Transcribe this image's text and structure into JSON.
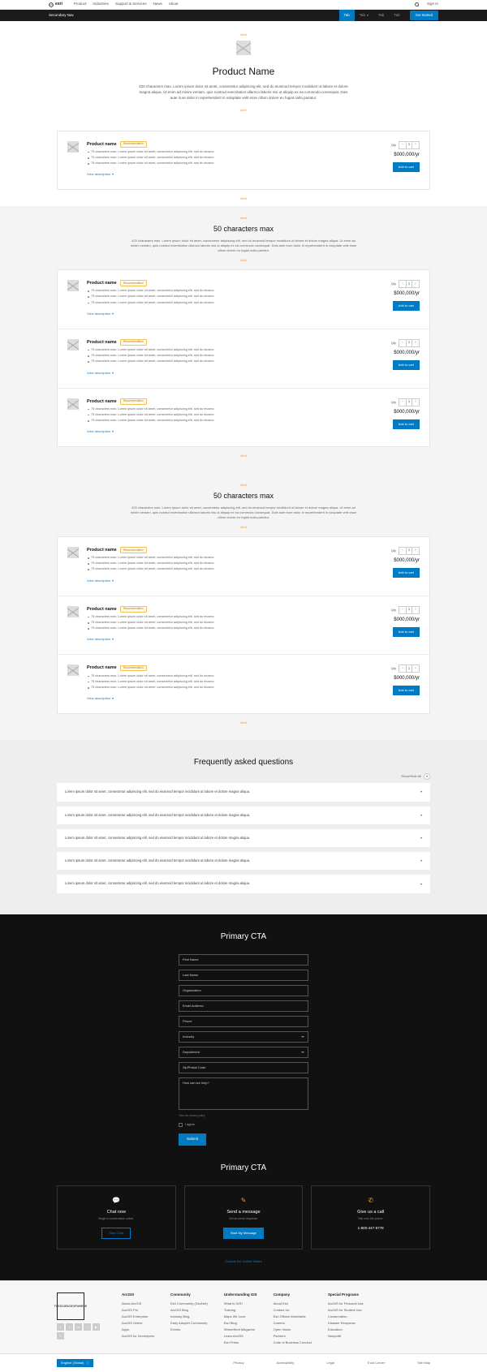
{
  "header": {
    "logo": "esri",
    "nav": [
      "Product",
      "Industries",
      "Support & Services",
      "News",
      "About"
    ],
    "signin": "Sign In"
  },
  "secondary": {
    "title": "Secondary Nav",
    "tabs": [
      "Tab",
      "Tab",
      "Tab",
      "Tab"
    ],
    "activeTab": 0,
    "cta": "Get Started"
  },
  "hero": {
    "alert": "Alert",
    "title": "Product Name",
    "desc": "420 characters max. Lorem ipsum dolor sit amet, consectetur adipiscing elit, sed do eiusmod tempor incididunt ut labore et dolore magna aliqua. Ut enim ad minim veniam, quis nostrud exercitation ullamco laboris nisi ut aliquip ex ea commodo consequat. Duis aute irure dolor in reprehenderit in voluptate velit esse cillum dolore eu fugiat nulla pariatur.",
    "alert2": "Alert"
  },
  "recommendation_label": "Recommendation",
  "bullet": "75 characters max. Lorem ipsum dolor sit amet, consectetur adipiscing elit, sed do eiusmo",
  "view_desc": "View description",
  "qty_label": "Qty",
  "price": "$000,000/yr",
  "add": "Add to cart",
  "groups": [
    {
      "alert": "Alert",
      "intro_title": "",
      "intro": "",
      "alert2": "",
      "cards": [
        {
          "name": "Product name"
        }
      ]
    },
    {
      "alert": "Alert",
      "intro_title": "50 characters max",
      "intro": "420 characters max. Lorem ipsum dolor sit amet, consectetur adipiscing elit, sed do eiusmod tempor incididunt ut labore et dolore magna aliqua. Ut enim ad minim veniam, quis nostrud exercitation ullamco laboris nisi ut aliquip ex ea commodo consequat. Duis aute irure dolor in reprehenderit in voluptate velit esse cillum dolore eu fugiat nulla pariatur.",
      "alert2": "Alert",
      "cards": [
        {
          "name": "Product name"
        },
        {
          "name": "Product name"
        },
        {
          "name": "Product name"
        }
      ]
    },
    {
      "alert": "Alert",
      "intro_title": "50 characters max",
      "intro": "420 characters max. Lorem ipsum dolor sit amet, consectetur adipiscing elit, sed do eiusmod tempor incididunt ut labore et dolore magna aliqua. Ut enim ad minim veniam, quis nostrud exercitation ullamco laboris nisi ut aliquip ex ea commodo consequat. Duis aute irure dolor in reprehenderit in voluptate velit esse cillum dolore eu fugiat nulla pariatur.",
      "alert2": "Alert",
      "cards": [
        {
          "name": "Product name"
        },
        {
          "name": "Product name"
        },
        {
          "name": "Product name"
        }
      ]
    }
  ],
  "faq": {
    "title": "Frequently asked questions",
    "expand": "Show/Hide All",
    "q": "Lorem ipsum dolor sit amet, consectetur adipiscing elit, sed do eiusmod tempor incididunt ut labore et dolore magna aliqua.",
    "count": 5
  },
  "form": {
    "title": "Primary CTA",
    "fields": [
      "First Name",
      "Last Name",
      "Organization",
      "Email Address",
      "Phone"
    ],
    "selects": [
      "Industry",
      "Department"
    ],
    "zip": "Zip/Postal Code",
    "ta": "How can we help?",
    "fine": "View our privacy policy",
    "checkbox": "I agree",
    "submit": "Submit"
  },
  "contact": {
    "title": "Primary CTA",
    "cards": [
      {
        "icon": "chat",
        "t": "Chat now",
        "d": "Begin a conversation online.",
        "btn": "Start Chat",
        "fill": false
      },
      {
        "icon": "msg",
        "t": "Send a message",
        "d": "Get an email response.",
        "btn": "Start My Message",
        "fill": true
      },
      {
        "icon": "phone",
        "t": "Give us a call",
        "d": "Talk over the phone.",
        "btn": "",
        "phone": "1-800-447-9778",
        "fill": false
      }
    ],
    "outside": "Outside the United States"
  },
  "footer": {
    "science": "THE\nSCIENCE\nOF\nWHERE",
    "cols": [
      {
        "h": "ArcGIS",
        "items": [
          "About ArcGIS",
          "ArcGIS Pro",
          "ArcGIS Enterprise",
          "ArcGIS Online",
          "Apps",
          "ArcGIS for Developers"
        ]
      },
      {
        "h": "Community",
        "items": [
          "Esri Community (GeoNet)",
          "ArcGIS Blog",
          "Industry Blog",
          "Early Adopter Community",
          "Events"
        ]
      },
      {
        "h": "Understanding GIS",
        "items": [
          "What is GIS?",
          "Training",
          "Maps We Love",
          "Esri Blog",
          "WhereNext Magazine",
          "Learn ArcGIS",
          "Esri Press"
        ]
      },
      {
        "h": "Company",
        "items": [
          "About Esri",
          "Contact Us",
          "Esri Offices Worldwide",
          "Careers",
          "Open Vision",
          "Partners",
          "Code of Business Conduct"
        ]
      },
      {
        "h": "Special Programs",
        "items": [
          "ArcGIS for Personal Use",
          "ArcGIS for Student Use",
          "Conservation",
          "Disaster Response",
          "Education",
          "Nonprofit"
        ]
      }
    ],
    "lang": "English (Global)",
    "legal": [
      "Privacy",
      "Accessibility",
      "Legal",
      "Trust Center",
      "Site Map"
    ]
  }
}
